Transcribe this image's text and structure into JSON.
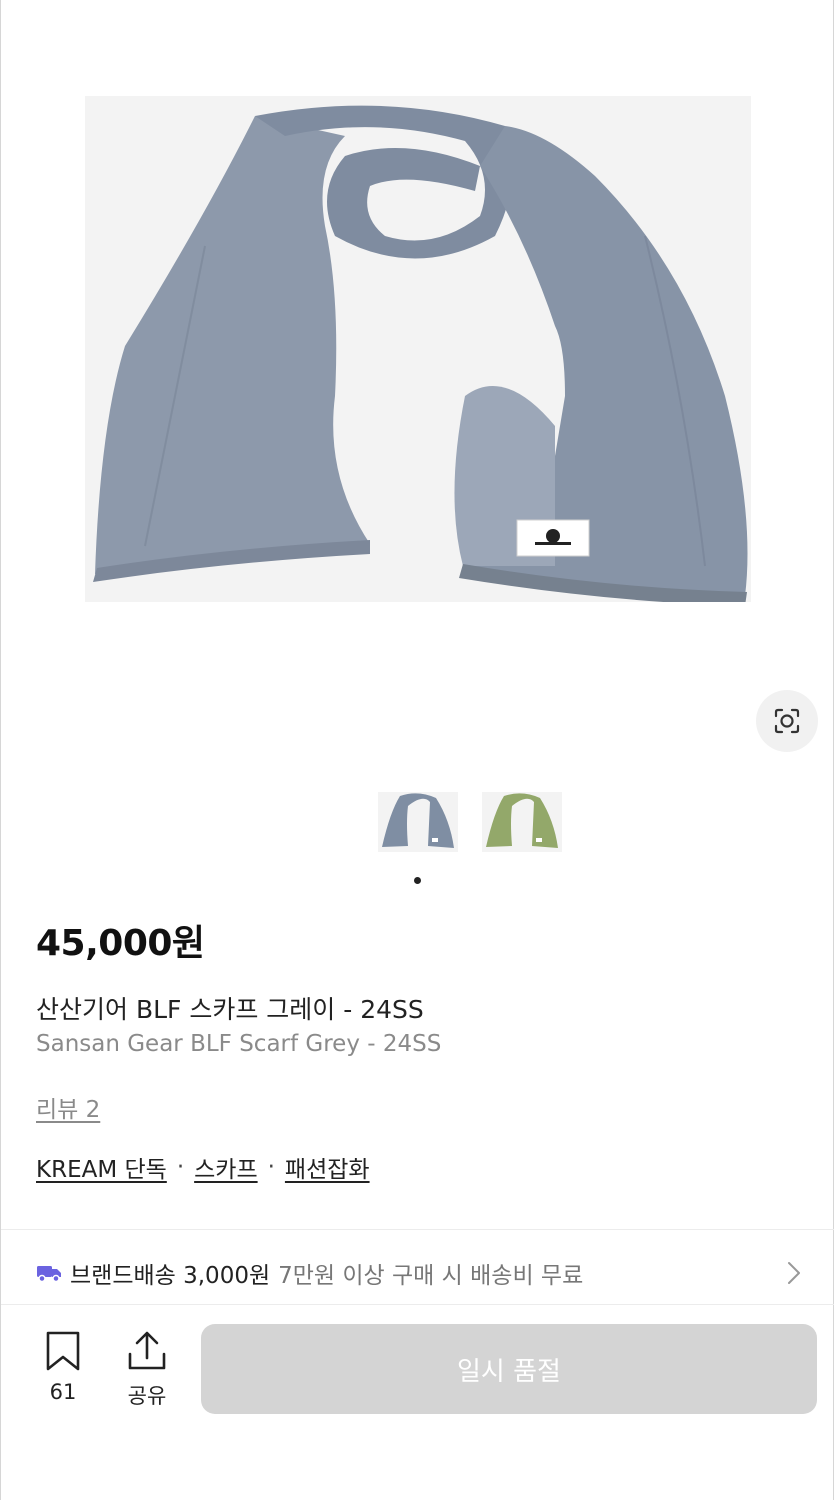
{
  "product": {
    "image_icon": "scarf-grey-photo",
    "price": "45,000원",
    "title_ko": "산산기어 BLF 스카프 그레이 - 24SS",
    "title_en": "Sansan Gear BLF Scarf Grey - 24SS",
    "review_link": "리뷰 2"
  },
  "gallery": {
    "thumbnails": [
      {
        "icon": "scarf-grey-thumbnail",
        "color": "#7f8ea3"
      },
      {
        "icon": "scarf-green-thumbnail",
        "color": "#93a86a"
      }
    ],
    "active_index": 0
  },
  "categories": {
    "items": [
      "KREAM 단독",
      "스카프",
      "패션잡화"
    ],
    "separator": "·"
  },
  "shipping": {
    "icon": "truck-icon",
    "label": "브랜드배송 3,000원",
    "note": "7만원 이상 구매 시 배송비 무료"
  },
  "actions": {
    "bookmark_count": "61",
    "share_label": "공유",
    "buy_button_label": "일시 품절"
  },
  "colors": {
    "accent_truck": "#6b63e0",
    "disabled_button": "#d4d4d4",
    "muted_text": "#8a8a8a"
  }
}
